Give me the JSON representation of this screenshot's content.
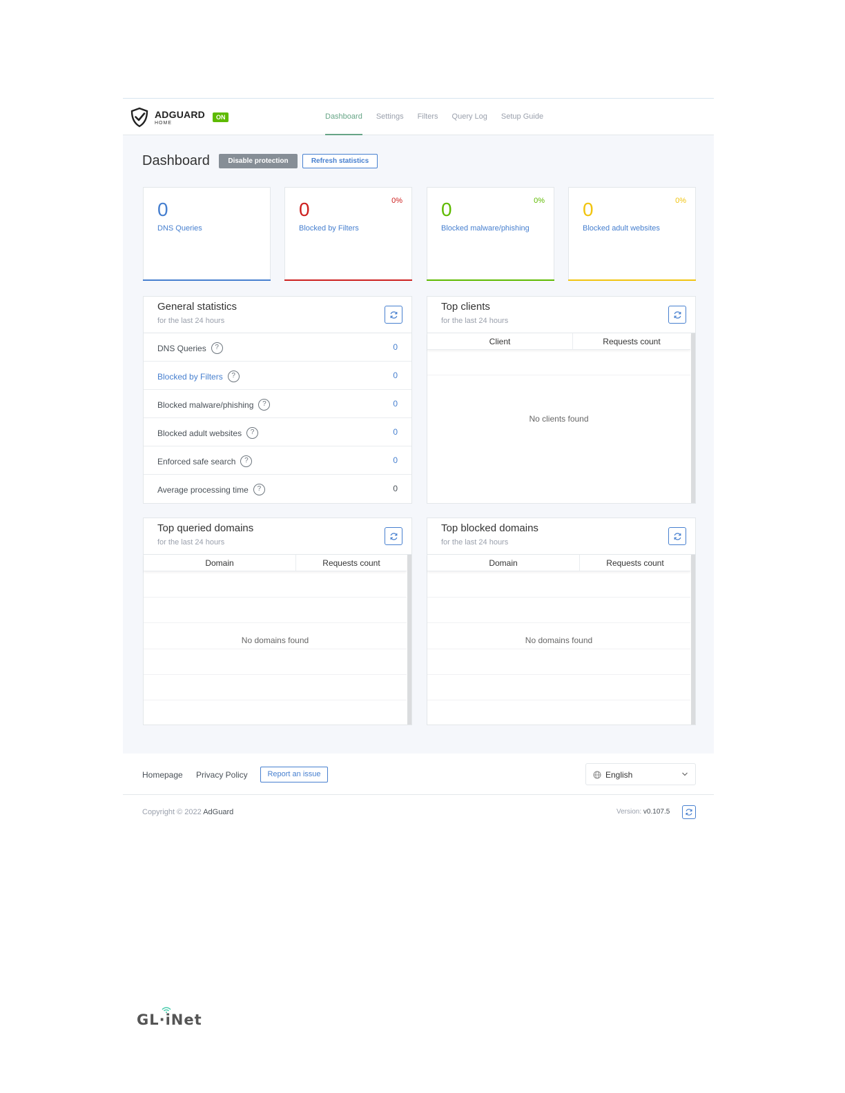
{
  "header": {
    "brand": "ADGUARD",
    "brand_sub": "HOME",
    "status_badge": "ON",
    "nav": [
      "Dashboard",
      "Settings",
      "Filters",
      "Query Log",
      "Setup Guide"
    ]
  },
  "page": {
    "title": "Dashboard",
    "disable_button": "Disable protection",
    "refresh_button": "Refresh statistics"
  },
  "stat_cards": [
    {
      "value": "0",
      "label": "DNS Queries",
      "percent": "",
      "color": "#467fcf"
    },
    {
      "value": "0",
      "label": "Blocked by Filters",
      "percent": "0%",
      "color": "#cd201f"
    },
    {
      "value": "0",
      "label": "Blocked malware/phishing",
      "percent": "0%",
      "color": "#5eba00"
    },
    {
      "value": "0",
      "label": "Blocked adult websites",
      "percent": "0%",
      "color": "#f1c40f"
    }
  ],
  "general_stats": {
    "title": "General statistics",
    "subtitle": "for the last 24 hours",
    "rows": [
      {
        "label": "DNS Queries",
        "value": "0"
      },
      {
        "label": "Blocked by Filters",
        "value": "0"
      },
      {
        "label": "Blocked malware/phishing",
        "value": "0"
      },
      {
        "label": "Blocked adult websites",
        "value": "0"
      },
      {
        "label": "Enforced safe search",
        "value": "0"
      },
      {
        "label": "Average processing time",
        "value": "0"
      }
    ],
    "help_glyph": "?"
  },
  "top_clients": {
    "title": "Top clients",
    "subtitle": "for the last 24 hours",
    "columns": [
      "Client",
      "Requests count"
    ],
    "empty": "No clients found"
  },
  "top_queried": {
    "title": "Top queried domains",
    "subtitle": "for the last 24 hours",
    "columns": [
      "Domain",
      "Requests count"
    ],
    "empty": "No domains found"
  },
  "top_blocked": {
    "title": "Top blocked domains",
    "subtitle": "for the last 24 hours",
    "columns": [
      "Domain",
      "Requests count"
    ],
    "empty": "No domains found"
  },
  "footer": {
    "homepage": "Homepage",
    "privacy": "Privacy Policy",
    "report": "Report an issue",
    "language": "English",
    "copyright_prefix": "Copyright © 2022",
    "copyright_name": "AdGuard",
    "version_label": "Version:",
    "version_value": "v0.107.5"
  },
  "watermark": "GL·iNet",
  "icons": [
    "shield-check-icon",
    "refresh-icon",
    "help-icon",
    "globe-icon",
    "chevron-down-icon",
    "wifi-icon"
  ]
}
